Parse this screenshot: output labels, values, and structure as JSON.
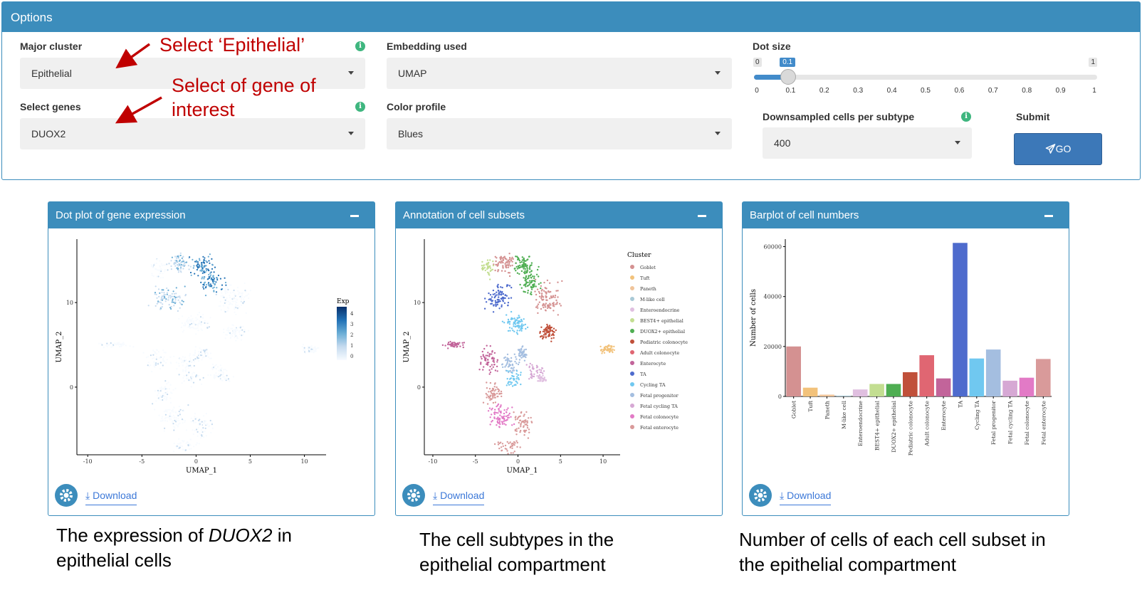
{
  "options": {
    "title": "Options",
    "major_cluster": {
      "label": "Major cluster",
      "value": "Epithelial"
    },
    "select_genes": {
      "label": "Select genes",
      "value": "DUOX2"
    },
    "embedding": {
      "label": "Embedding used",
      "value": "UMAP"
    },
    "color_profile": {
      "label": "Color profile",
      "value": "Blues"
    },
    "dot_size": {
      "label": "Dot size",
      "min": 0,
      "max": 1,
      "value": 0.1,
      "min_label": "0",
      "max_label": "1",
      "value_label": "0.1",
      "ticks": [
        "0",
        "0.1",
        "0.2",
        "0.3",
        "0.4",
        "0.5",
        "0.6",
        "0.7",
        "0.8",
        "0.9",
        "1"
      ]
    },
    "downsampled": {
      "label": "Downsampled cells per subtype",
      "value": "400"
    },
    "submit": {
      "label": "Submit",
      "button": "GO"
    },
    "info_glyph": "i"
  },
  "annotations": {
    "select_epithelial": "Select ‘Epithelial’",
    "select_gene_line1": "Select of gene of",
    "select_gene_line2": "interest",
    "arrow_color": "#c00000"
  },
  "panels": [
    {
      "title": "Dot plot of gene expression",
      "download": "Download"
    },
    {
      "title": "Annotation of cell subsets",
      "download": "Download"
    },
    {
      "title": "Barplot of cell numbers",
      "download": "Download"
    }
  ],
  "umap_axes": {
    "xlabel": "UMAP_1",
    "ylabel": "UMAP_2",
    "xticks": [
      "-10",
      "-5",
      "0",
      "5",
      "10"
    ],
    "yticks": [
      "0",
      "10"
    ]
  },
  "expression_legend": {
    "title": "Exp",
    "ticks": [
      "4",
      "3",
      "2",
      "1",
      "0"
    ],
    "colors": [
      "#08306b",
      "#2171b5",
      "#6baed6",
      "#c6dbef",
      "#f7fbff"
    ]
  },
  "cluster_legend": {
    "title": "Cluster",
    "items": [
      {
        "name": "Goblet",
        "color": "#d49191"
      },
      {
        "name": "Tuft",
        "color": "#f2c27b"
      },
      {
        "name": "Paneth",
        "color": "#f0c49a"
      },
      {
        "name": "M-like cell",
        "color": "#a9c9d6"
      },
      {
        "name": "Enteroendocrine",
        "color": "#e0bfe0"
      },
      {
        "name": "BEST4+ epithelial",
        "color": "#c3de91"
      },
      {
        "name": "DUOX2+ epithelial",
        "color": "#4fae52"
      },
      {
        "name": "Pediatric colonocyte",
        "color": "#c0503a"
      },
      {
        "name": "Adult colonocyte",
        "color": "#e06672"
      },
      {
        "name": "Enterocyte",
        "color": "#c2649a"
      },
      {
        "name": "TA",
        "color": "#4e6bcd"
      },
      {
        "name": "Cycling TA",
        "color": "#70c8f0"
      },
      {
        "name": "Fetal progenitor",
        "color": "#a4bee0"
      },
      {
        "name": "Fetal cycling TA",
        "color": "#d6a8d4"
      },
      {
        "name": "Fetal colonocyte",
        "color": "#e27ac6"
      },
      {
        "name": "Fetal enterocyte",
        "color": "#d99a9a"
      }
    ]
  },
  "chart_data": {
    "type": "bar",
    "ylabel": "Number of cells",
    "xlabel": "",
    "ylim": [
      0,
      63000
    ],
    "yticks": [
      "0",
      "20000",
      "40000",
      "60000"
    ],
    "categories": [
      "Goblet",
      "Tuft",
      "Paneth",
      "M-like cell",
      "Enteroendocrine",
      "BEST4+ epithelial",
      "DUOX2+ epithelial",
      "Pediatric colonocyte",
      "Adult colonocyte",
      "Enterocyte",
      "TA",
      "Cycling TA",
      "Fetal progenitor",
      "Fetal cycling TA",
      "Fetal colonocyte",
      "Fetal enterocyte"
    ],
    "values": [
      20000,
      3500,
      700,
      300,
      2800,
      5000,
      5000,
      9700,
      16500,
      7200,
      61500,
      15200,
      18800,
      6300,
      7500,
      15000
    ],
    "colors": [
      "#d49191",
      "#f2c27b",
      "#f0c49a",
      "#a9c9d6",
      "#e0bfe0",
      "#c3de91",
      "#4fae52",
      "#c0503a",
      "#e06672",
      "#c2649a",
      "#4e6bcd",
      "#70c8f0",
      "#a4bee0",
      "#d6a8d4",
      "#e27ac6",
      "#d99a9a"
    ]
  },
  "captions": {
    "caption1_pre": "The expression of ",
    "caption1_gene": "DUOX2",
    "caption1_post": " in",
    "caption1_line2": "epithelial cells",
    "caption2_line1": "The cell subtypes in the",
    "caption2_line2": "epithelial compartment",
    "caption3_line1": "Number of cells of each cell subset in",
    "caption3_line2": "the epithelial compartment"
  }
}
